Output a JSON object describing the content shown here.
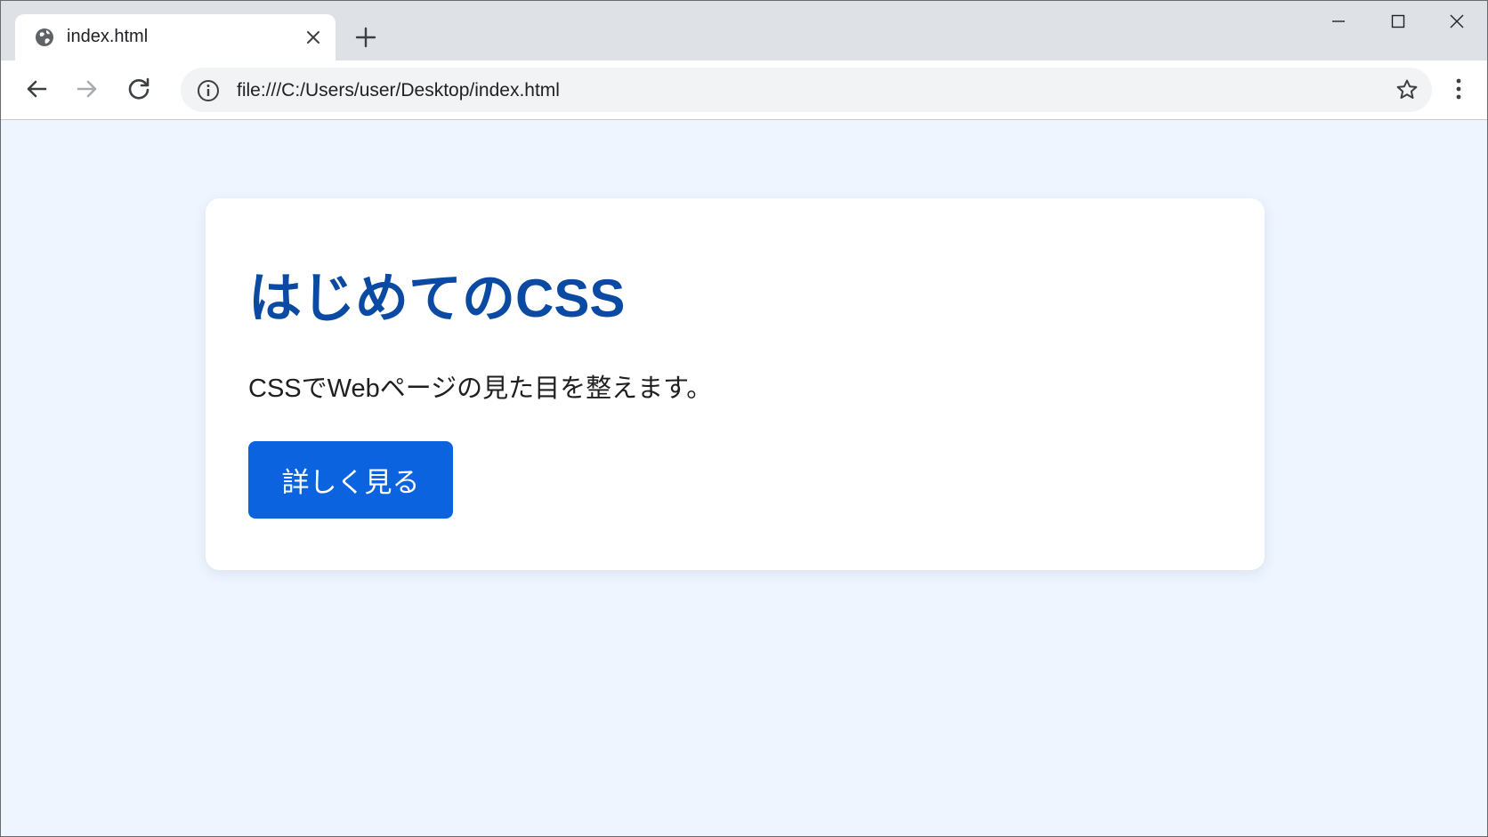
{
  "browser": {
    "tab": {
      "title": "index.html"
    },
    "address_bar": {
      "url": "file:///C:/Users/user/Desktop/index.html"
    },
    "icons": {
      "favicon": "globe-icon",
      "close": "close-icon",
      "new_tab": "plus-icon",
      "back": "arrow-left-icon",
      "forward": "arrow-right-icon",
      "reload": "reload-icon",
      "info": "info-icon",
      "bookmark": "star-icon",
      "menu": "kebab-menu-icon",
      "minimize": "minimize-icon",
      "maximize": "maximize-icon",
      "window_close": "close-icon"
    }
  },
  "page": {
    "title": "はじめてのCSS",
    "text": "CSSでWebページの見た目を整えます。",
    "button_label": "詳しく見る"
  },
  "colors": {
    "page_background": "#eef5ff",
    "title": "#0b4aa2",
    "button": "#0c63e0",
    "button_text": "#ffffff"
  }
}
